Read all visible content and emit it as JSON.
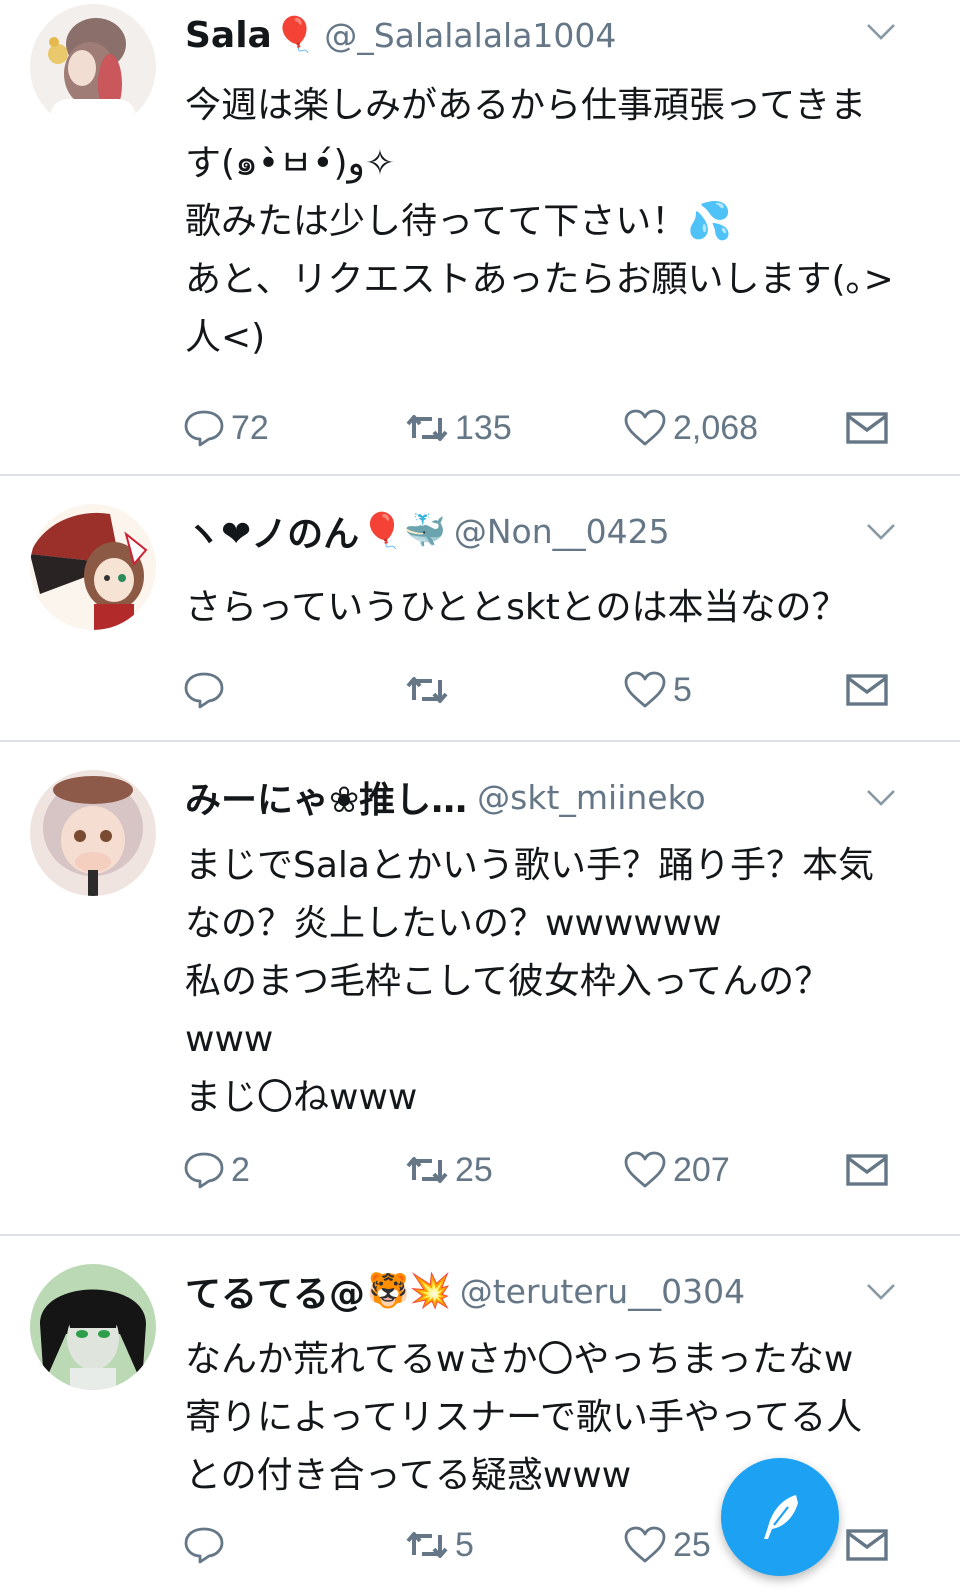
{
  "tweets": [
    {
      "display_name": "Sala",
      "name_emoji": "🎈",
      "handle": "@_Salalalala1004",
      "text": "今週は楽しみがあるから仕事頑張ってきま\nす(๑•̀ㅂ•́)و✧\n歌みたは少し待ってて下さい！💦\nあと、リクエストあったらお願いします(｡>\n人<)",
      "reply_count": "72",
      "retweet_count": "135",
      "like_count": "2,068"
    },
    {
      "display_name": "ヽ❤ノのん",
      "name_emoji": "🎈🐳",
      "handle": "@Non__0425",
      "text": "さらっていうひととsktとのは本当なの？",
      "reply_count": "",
      "retweet_count": "",
      "like_count": "5"
    },
    {
      "display_name": "みーにゃ❀推し…",
      "name_emoji": "",
      "handle": "@skt_miineko",
      "text": "まじでSalaとかいう歌い手？踊り手？本気\nなの？炎上したいの？wwwwww\n私のまつ毛枠こして彼女枠入ってんの？\nwww\nまじ〇ねwww",
      "reply_count": "2",
      "retweet_count": "25",
      "like_count": "207"
    },
    {
      "display_name": "てるてる@",
      "name_emoji": "🐯💥",
      "handle": "@teruteru__0304",
      "text": "なんか荒れてるwさか〇やっちまったなw\n寄りによってリスナーで歌い手やってる人\nとの付き合ってる疑惑www",
      "reply_count": "",
      "retweet_count": "5",
      "like_count": "25"
    }
  ],
  "icons": {
    "reply": "reply-icon",
    "retweet": "retweet-icon",
    "like": "heart-icon",
    "dm": "envelope-icon",
    "caret": "chevron-down-icon",
    "compose": "feather-icon"
  },
  "colors": {
    "accent": "#1da1f2",
    "icon_gray": "#657786",
    "divider": "#dde1e5"
  }
}
